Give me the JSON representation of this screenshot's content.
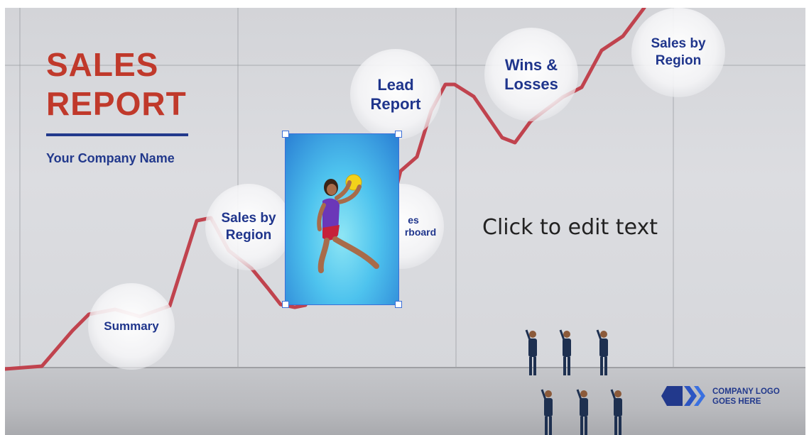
{
  "slide": {
    "title_line1": "SALES",
    "title_line2": "REPORT",
    "company_name": "Your Company Name",
    "edit_placeholder": "Click to edit text",
    "logo_text_line1": "COMPANY LOGO",
    "logo_text_line2": "GOES HERE"
  },
  "bubbles": {
    "summary": "Summary",
    "sales_by_region_low_1": "Sales by",
    "sales_by_region_low_2": "Region",
    "scoreboard_1": "es",
    "scoreboard_2": "rboard",
    "lead_1": "Lead",
    "lead_2": "Report",
    "wins_1": "Wins &",
    "wins_2": "Losses",
    "sales_by_region_high_1": "Sales by",
    "sales_by_region_high_2": "Region"
  },
  "colors": {
    "title_red": "#c0392b",
    "brand_blue": "#22398c",
    "trend_line": "#c0434e",
    "selection_blue": "#3b6fd8"
  }
}
